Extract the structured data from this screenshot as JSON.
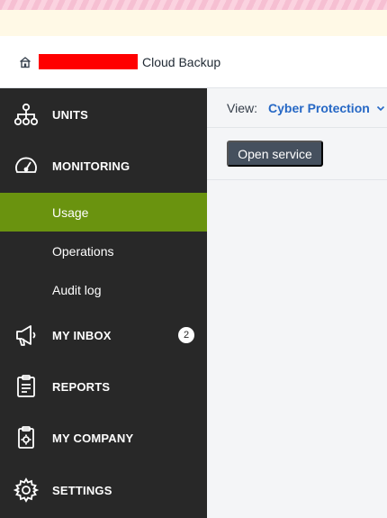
{
  "header": {
    "title": "Cloud Backup"
  },
  "sidebar": {
    "items": [
      {
        "label": "UNITS"
      },
      {
        "label": "MONITORING"
      },
      {
        "label": "MY INBOX",
        "badge": "2"
      },
      {
        "label": "REPORTS"
      },
      {
        "label": "MY COMPANY"
      },
      {
        "label": "SETTINGS"
      }
    ],
    "monitoring_sub": [
      {
        "label": "Usage",
        "active": true
      },
      {
        "label": "Operations"
      },
      {
        "label": "Audit log"
      }
    ]
  },
  "main": {
    "view_label": "View:",
    "view_value": "Cyber Protection",
    "open_service_label": "Open service"
  },
  "colors": {
    "sidebar_bg": "#282828",
    "active_item": "#6a930f",
    "link_blue": "#2668c5",
    "button_bg": "#45505e"
  },
  "icons": [
    "home-icon",
    "units-icon",
    "monitoring-icon",
    "inbox-icon",
    "reports-icon",
    "company-icon",
    "settings-icon",
    "chevron-down-icon"
  ]
}
